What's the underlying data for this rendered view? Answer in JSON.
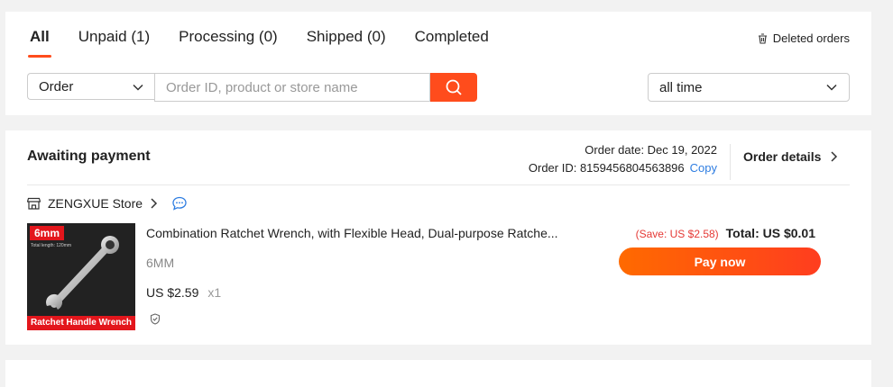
{
  "tabs": [
    "All",
    "Unpaid (1)",
    "Processing (0)",
    "Shipped (0)",
    "Completed"
  ],
  "deleted_orders": "Deleted orders",
  "filters": {
    "order_type": "Order",
    "search_placeholder": "Order ID, product or store name",
    "time_range": "all time"
  },
  "order": {
    "status": "Awaiting payment",
    "order_date": "Order date: Dec 19, 2022",
    "order_id": "Order ID: 8159456804563896",
    "copy_label": "Copy",
    "details_label": "Order details",
    "store_name": "ZENGXUE Store",
    "product": {
      "title": "Combination Ratchet Wrench, with Flexible Head, Dual-purpose Ratche...",
      "variant": "6MM",
      "price": "US $2.59",
      "quantity": "x1",
      "image_badge": "6mm",
      "image_caption": "Total length: 120mm",
      "image_banner": "Ratchet Handle Wrench"
    },
    "savings": "(Save: US $2.58)",
    "total": "Total: US $0.01",
    "pay_button": "Pay now"
  },
  "colors": {
    "accent": "#ff4c1c",
    "link": "#2e7de1",
    "save_text": "#e53935"
  }
}
